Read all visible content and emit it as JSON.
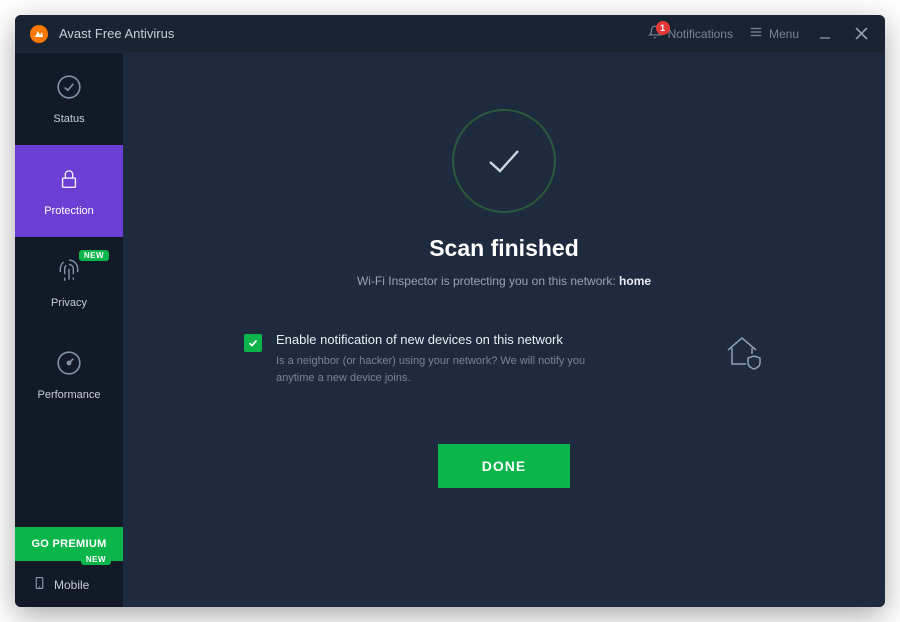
{
  "app": {
    "title": "Avast Free Antivirus"
  },
  "titlebar": {
    "notifications_label": "Notifications",
    "notifications_count": "1",
    "menu_label": "Menu"
  },
  "sidebar": {
    "items": [
      {
        "label": "Status",
        "icon": "check-circle-icon"
      },
      {
        "label": "Protection",
        "icon": "lock-icon",
        "active": true
      },
      {
        "label": "Privacy",
        "icon": "fingerprint-icon",
        "badge": "NEW"
      },
      {
        "label": "Performance",
        "icon": "gauge-icon"
      }
    ],
    "go_premium_label": "GO PREMIUM",
    "mobile": {
      "label": "Mobile",
      "badge": "NEW"
    }
  },
  "main": {
    "title": "Scan finished",
    "subtitle_prefix": "Wi-Fi Inspector is protecting you on this network: ",
    "network_name": "home",
    "notify": {
      "checked": true,
      "title": "Enable notification of new devices on this network",
      "description": "Is a neighbor (or hacker) using your network? We will notify you anytime a new device joins."
    },
    "done_label": "DONE"
  },
  "colors": {
    "accent_green": "#0ab54a",
    "accent_purple": "#6b3fd4",
    "bg_dark": "#1a2332",
    "bg_sidebar": "#121a27",
    "bg_main": "#1e2a3d"
  }
}
